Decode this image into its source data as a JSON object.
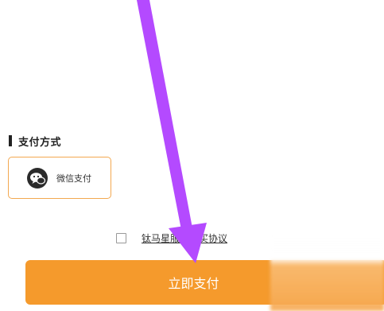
{
  "payment_section": {
    "title": "支付方式",
    "options": [
      {
        "label": "微信支付",
        "icon": "wechat-icon",
        "selected": true
      }
    ]
  },
  "agreement": {
    "checked": false,
    "link_text": "钛马星服务购买协议"
  },
  "pay_button": {
    "label": "立即支付"
  },
  "colors": {
    "accent": "#f59a2c",
    "option_border": "#f3a850",
    "annotation_arrow": "#b44aff"
  }
}
